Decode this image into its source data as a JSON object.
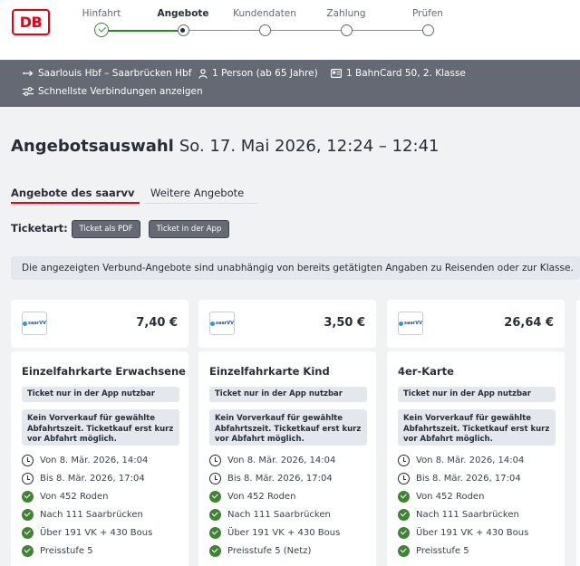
{
  "header": {
    "logo_text": "DB",
    "steps": [
      {
        "label": "Hinfahrt",
        "state": "done"
      },
      {
        "label": "Angebote",
        "state": "current"
      },
      {
        "label": "Kundendaten",
        "state": "todo"
      },
      {
        "label": "Zahlung",
        "state": "todo"
      },
      {
        "label": "Prüfen",
        "state": "todo"
      }
    ]
  },
  "summary": {
    "route": "Saarlouis Hbf – Saarbrücken Hbf",
    "travellers": "1 Person (ab 65 Jahre)",
    "bahncard": "1 BahnCard 50, 2. Klasse",
    "fastest": "Schnellste Verbindungen anzeigen"
  },
  "page": {
    "title": "Angebotsauswahl",
    "date_time": "So. 17. Mai 2026, 12:24 – 12:41"
  },
  "tabs": [
    {
      "label": "Angebote des saarvv",
      "active": true
    },
    {
      "label": "Weitere Angebote",
      "active": false
    }
  ],
  "ticket_type": {
    "label": "Ticketart:",
    "options": [
      "Ticket als PDF",
      "Ticket in der App"
    ]
  },
  "notice": "Die angezeigten Verbund-Angebote sind unabhängig von bereits getätigten Angaben zu Reisenden oder zur Klasse.",
  "offers": [
    {
      "operator_logo": "saarVV",
      "price": "7,40 €",
      "title": "Einzelfahrkarte Erwachsene",
      "app_only": "Ticket nur in der App nutzbar",
      "info": "Kein Vorverkauf für gewählte Abfahrtszeit. Ticketkauf erst kurz vor Abfahrt möglich.",
      "details": [
        {
          "icon": "clock-icon",
          "text": "Von 8. Mär. 2026, 14:04"
        },
        {
          "icon": "clock-icon",
          "text": "Bis 8. Mär. 2026, 17:04"
        },
        {
          "icon": "check-icon",
          "text": "Von 452 Roden"
        },
        {
          "icon": "check-icon",
          "text": "Nach 111 Saarbrücken"
        },
        {
          "icon": "check-icon",
          "text": "Über 191 VK + 430 Bous"
        },
        {
          "icon": "check-icon",
          "text": "Preisstufe 5"
        }
      ]
    },
    {
      "operator_logo": "saarVV",
      "price": "3,50 €",
      "title": "Einzelfahrkarte Kind",
      "app_only": "Ticket nur in der App nutzbar",
      "info": "Kein Vorverkauf für gewählte Abfahrtszeit. Ticketkauf erst kurz vor Abfahrt möglich.",
      "details": [
        {
          "icon": "clock-icon",
          "text": "Von 8. Mär. 2026, 14:04"
        },
        {
          "icon": "clock-icon",
          "text": "Bis 8. Mär. 2026, 17:04"
        },
        {
          "icon": "check-icon",
          "text": "Von 452 Roden"
        },
        {
          "icon": "check-icon",
          "text": "Nach 111 Saarbrücken"
        },
        {
          "icon": "check-icon",
          "text": "Über 191 VK + 430 Bous"
        },
        {
          "icon": "check-icon",
          "text": "Preisstufe 5 (Netz)"
        }
      ]
    },
    {
      "operator_logo": "saarVV",
      "price": "26,64 €",
      "title": "4er-Karte",
      "app_only": "Ticket nur in der App nutzbar",
      "info": "Kein Vorverkauf für gewählte Abfahrtszeit. Ticketkauf erst kurz vor Abfahrt möglich.",
      "details": [
        {
          "icon": "clock-icon",
          "text": "Von 8. Mär. 2026, 14:04"
        },
        {
          "icon": "clock-icon",
          "text": "Bis 8. Mär. 2026, 17:04"
        },
        {
          "icon": "check-icon",
          "text": "Von 452 Roden"
        },
        {
          "icon": "check-icon",
          "text": "Nach 111 Saarbrücken"
        },
        {
          "icon": "check-icon",
          "text": "Über 191 VK + 430 Bous"
        },
        {
          "icon": "check-icon",
          "text": "Preisstufe 5"
        }
      ]
    }
  ],
  "colors": {
    "brand_red": "#ec0016",
    "done_green": "#408335",
    "summary_bg": "#646973",
    "page_bg": "#f0f2f4"
  }
}
